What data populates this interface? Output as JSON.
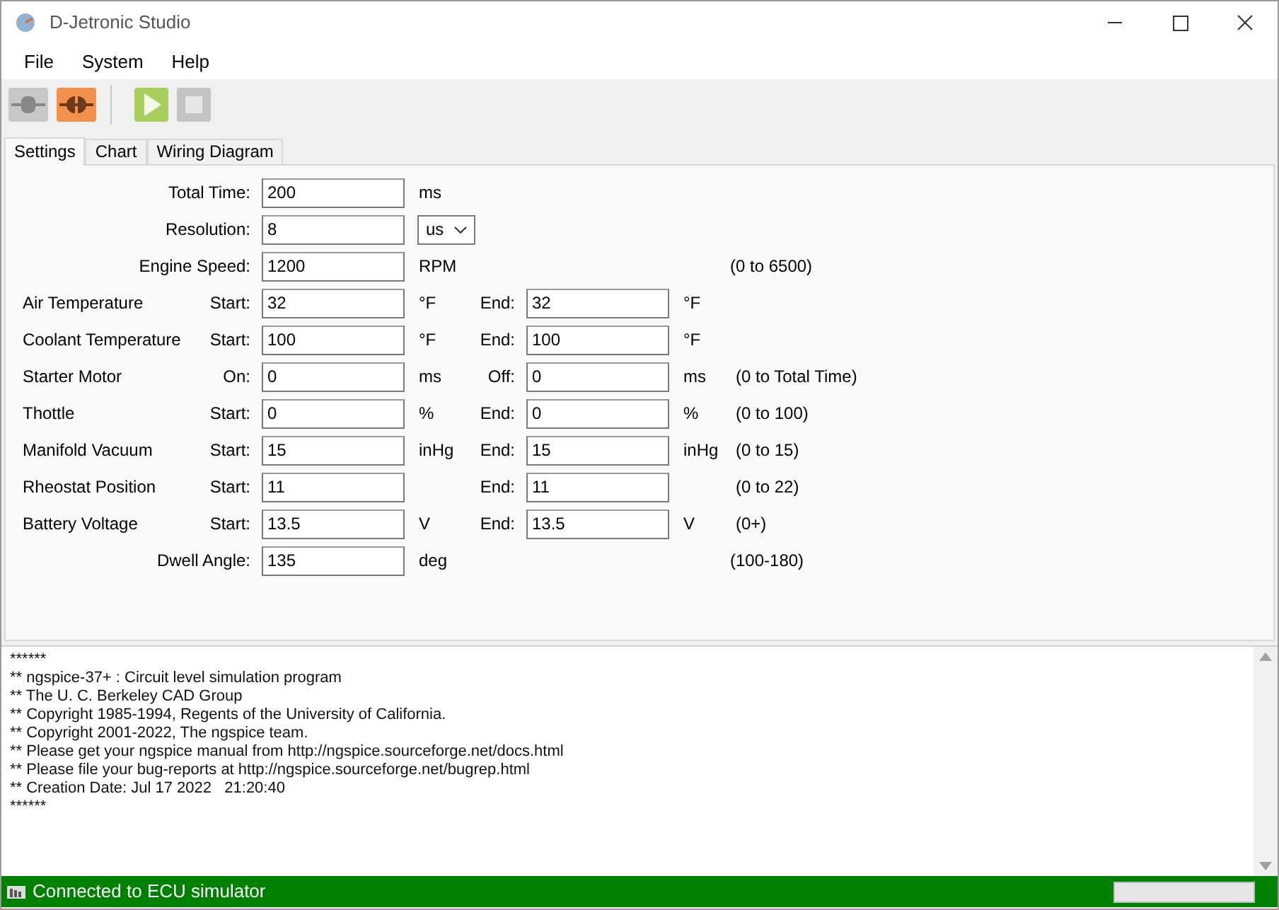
{
  "window": {
    "title": "D-Jetronic Studio"
  },
  "menu": [
    "File",
    "System",
    "Help"
  ],
  "toolbar": [
    {
      "kind": "connect",
      "disabled": true
    },
    {
      "kind": "disconnect",
      "disabled": false
    },
    {
      "kind": "run",
      "disabled": false
    },
    {
      "kind": "stop",
      "disabled": true
    }
  ],
  "tabs": [
    {
      "label": "Settings",
      "selected": true
    },
    {
      "label": "Chart",
      "selected": false
    },
    {
      "label": "Wiring Diagram",
      "selected": false
    }
  ],
  "settings": [
    {
      "label": "Total Time:",
      "fields": [
        {
          "value": "200",
          "unit": "ms"
        }
      ]
    },
    {
      "label": "Resolution:",
      "fields": [
        {
          "value": "8"
        }
      ],
      "dropdown": "us"
    },
    {
      "label": "Engine Speed:",
      "fields": [
        {
          "value": "1200",
          "unit": "RPM"
        }
      ],
      "range": "(0 to 6500)"
    },
    {
      "group": "Air Temperature",
      "fields": [
        {
          "label": "Start:",
          "value": "32",
          "unit": "°F"
        },
        {
          "label": "End:",
          "value": "32",
          "unit": "°F"
        }
      ]
    },
    {
      "group": "Coolant Temperature",
      "fields": [
        {
          "label": "Start:",
          "value": "100",
          "unit": "°F"
        },
        {
          "label": "End:",
          "value": "100",
          "unit": "°F"
        }
      ]
    },
    {
      "group": "Starter Motor",
      "fields": [
        {
          "label": "On:",
          "value": "0",
          "unit": "ms"
        },
        {
          "label": "Off:",
          "value": "0",
          "unit": "ms"
        }
      ],
      "range": "(0 to Total Time)"
    },
    {
      "group": "Thottle",
      "fields": [
        {
          "label": "Start:",
          "value": "0",
          "unit": "%"
        },
        {
          "label": "End:",
          "value": "0",
          "unit": "%"
        }
      ],
      "range": "(0 to 100)"
    },
    {
      "group": "Manifold Vacuum",
      "fields": [
        {
          "label": "Start:",
          "value": "15",
          "unit": "inHg"
        },
        {
          "label": "End:",
          "value": "15",
          "unit": "inHg"
        }
      ],
      "range": "(0 to 15)"
    },
    {
      "group": "Rheostat Position",
      "fields": [
        {
          "label": "Start:",
          "value": "11"
        },
        {
          "label": "End:",
          "value": "11"
        }
      ],
      "range": "(0 to 22)"
    },
    {
      "group": "Battery Voltage",
      "fields": [
        {
          "label": "Start:",
          "value": "13.5",
          "unit": "V"
        },
        {
          "label": "End:",
          "value": "13.5",
          "unit": "V"
        }
      ],
      "range": "(0+)"
    },
    {
      "label": "Dwell Angle:",
      "fields": [
        {
          "value": "135",
          "unit": "deg"
        }
      ],
      "range": "(100-180)"
    }
  ],
  "log": [
    "******",
    "** ngspice-37+ : Circuit level simulation program",
    "** The U. C. Berkeley CAD Group",
    "** Copyright 1985-1994, Regents of the University of California.",
    "** Copyright 2001-2022, The ngspice team.",
    "** Please get your ngspice manual from http://ngspice.sourceforge.net/docs.html",
    "** Please file your bug-reports at http://ngspice.sourceforge.net/bugrep.html",
    "** Creation Date: Jul 17 2022   21:20:40",
    "******"
  ],
  "status_bar": {
    "text": "Connected to ECU simulator",
    "progress": {
      "level": 0
    }
  }
}
